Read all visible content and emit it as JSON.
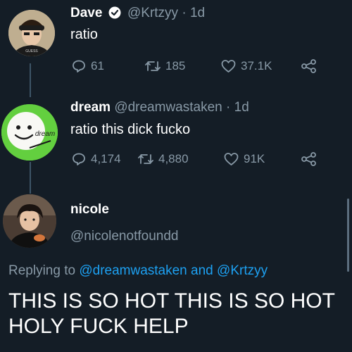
{
  "tweets": [
    {
      "name": "Dave",
      "handle": "@Krtzyy",
      "time": "· 1d",
      "text": "ratio",
      "replies": "61",
      "retweets": "185",
      "likes": "37.1K",
      "verified": true
    },
    {
      "name": "dream",
      "handle": "@dreamwastaken",
      "time": "· 1d",
      "text": "ratio this dick fucko",
      "replies": "4,174",
      "retweets": "4,880",
      "likes": "91K",
      "avatar_label": "dream"
    }
  ],
  "reply": {
    "name": "nicole",
    "handle": "@nicolenotfoundd",
    "replying_prefix": "Replying to",
    "replying_user1": "@dreamwastaken",
    "replying_and": "and",
    "replying_user2": "@Krtzyy",
    "text": "THIS IS SO HOT THIS IS SO HOT HOLY FUCK HELP"
  },
  "colors": {
    "background": "#141d26",
    "muted": "#8899a6",
    "link": "#1da1f2",
    "verified": "#ffffff"
  }
}
